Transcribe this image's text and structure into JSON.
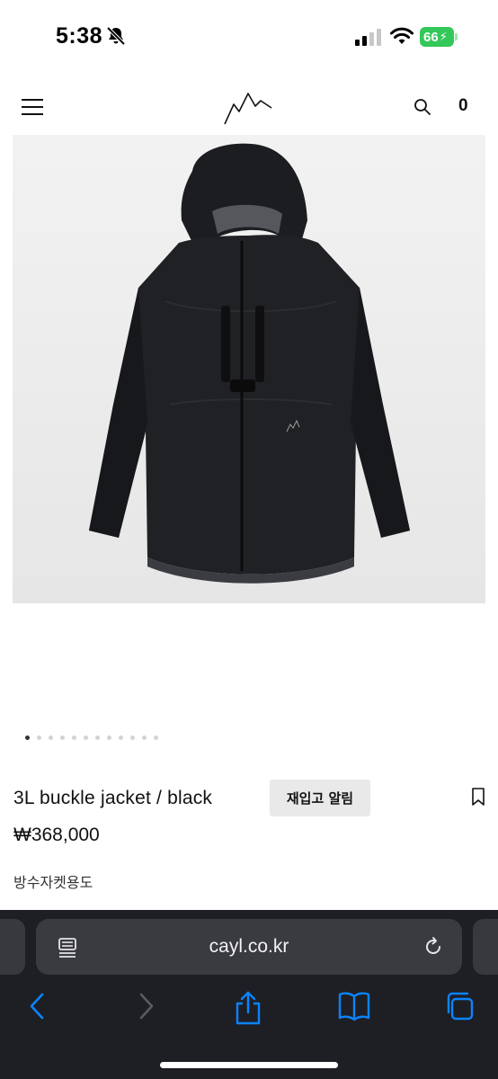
{
  "status_bar": {
    "time": "5:38",
    "battery": "66",
    "battery_color": "#34c759"
  },
  "header": {
    "menu_icon": "hamburger-icon",
    "logo_icon": "mountain-logo-icon",
    "search_icon": "search-icon",
    "cart_count": "0"
  },
  "product": {
    "image_alt": "black hooded jacket",
    "carousel": {
      "total": 12,
      "active_index": 0
    },
    "title": "3L buckle jacket / black",
    "restock_label": "재입고 알림",
    "price": "₩368,000",
    "description": "방수자켓용도"
  },
  "browser": {
    "url": "cayl.co.kr",
    "background": "#1e1f24",
    "accent": "#0a84ff",
    "toolbar_icons": [
      "back-icon",
      "forward-icon",
      "share-icon",
      "bookmarks-icon",
      "tabs-icon"
    ]
  }
}
